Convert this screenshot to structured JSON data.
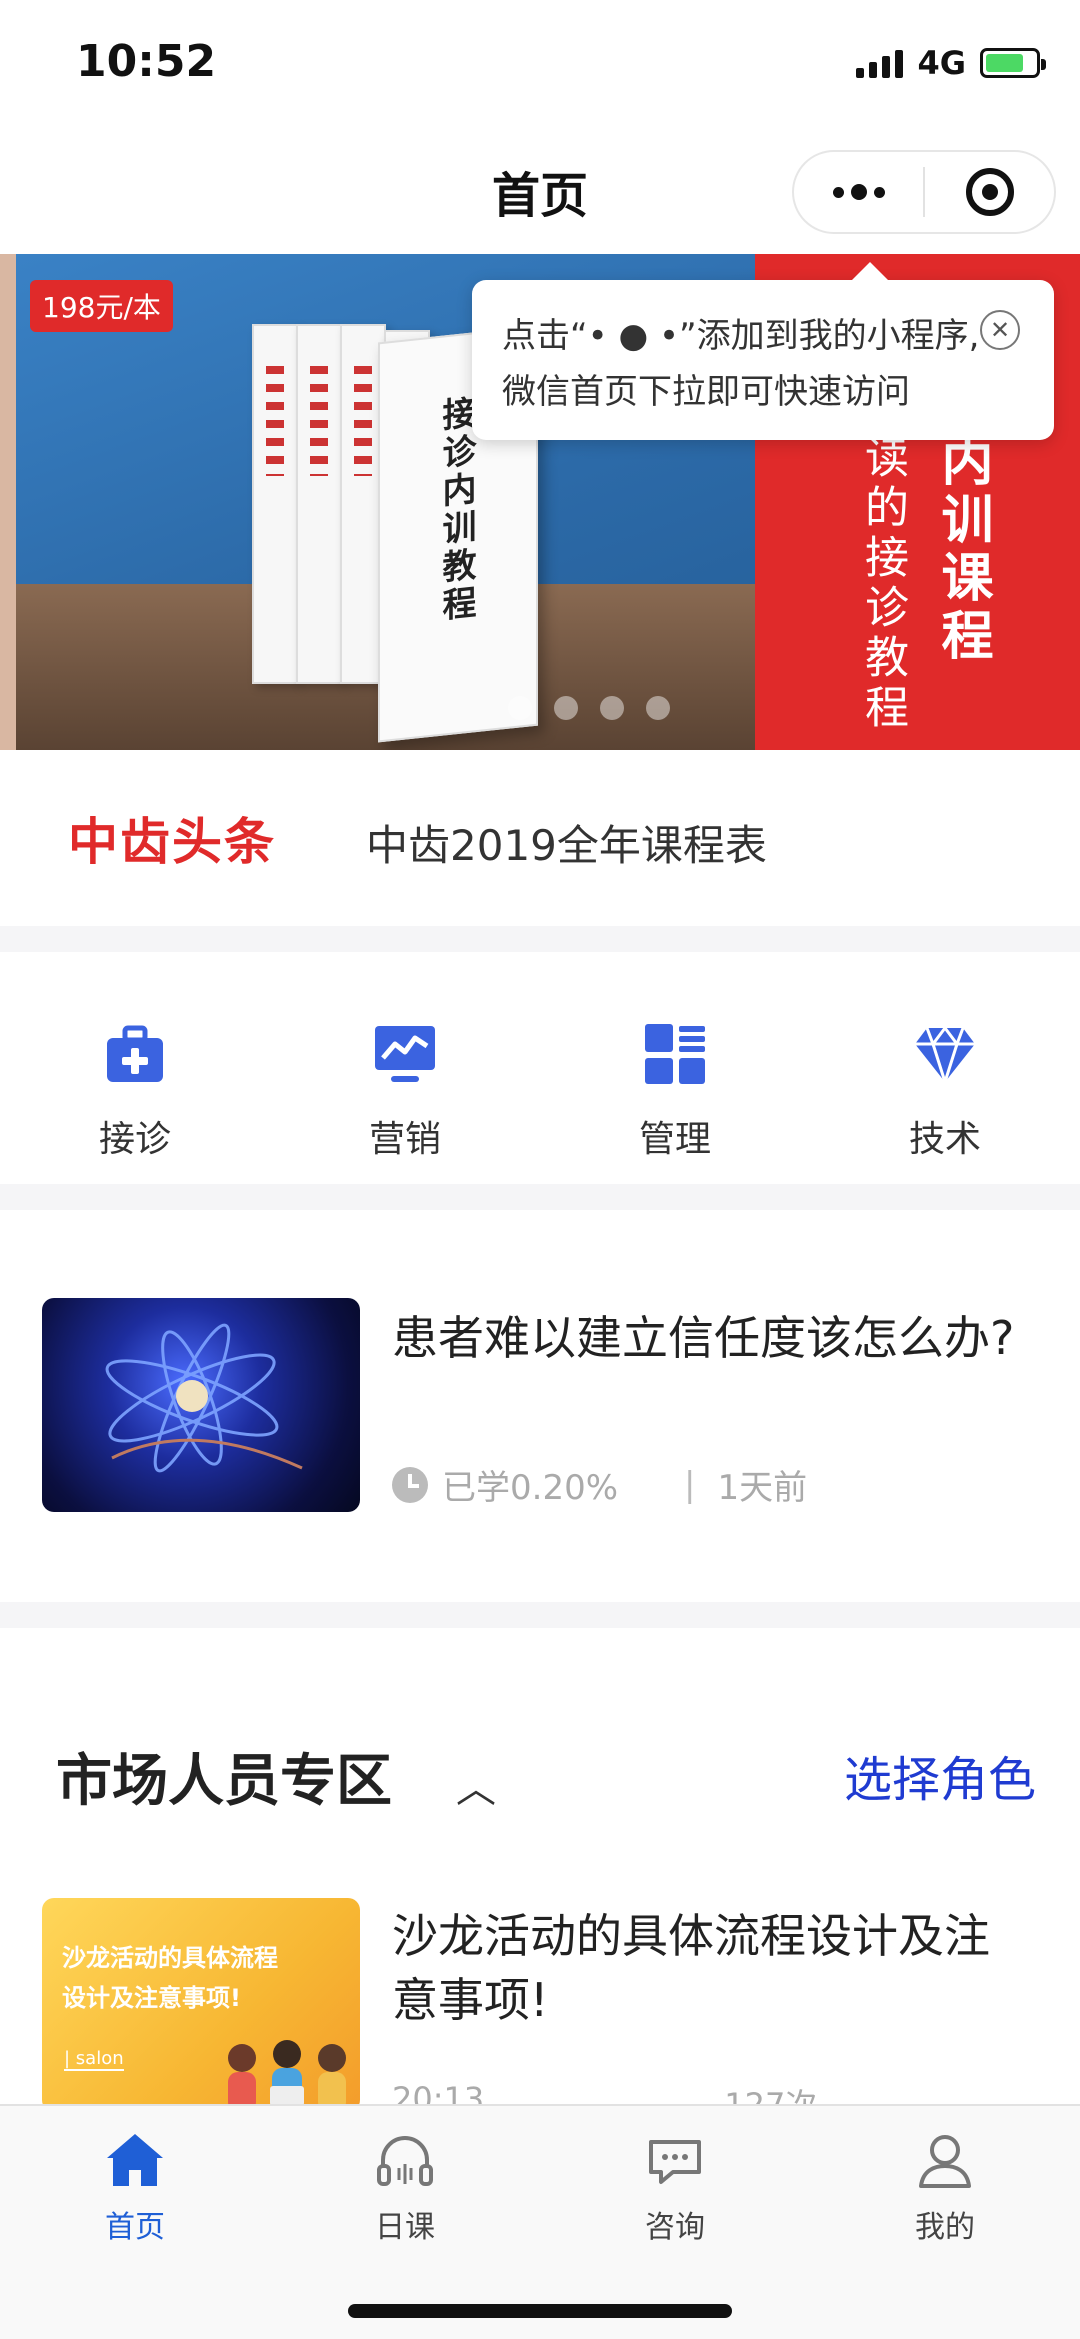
{
  "status_bar": {
    "time": "10:52",
    "network": "4G"
  },
  "nav": {
    "title": "首页"
  },
  "banner": {
    "price": "198元/本",
    "book_title": "接诊内训教程",
    "red_panel_line1": "内训课程",
    "red_panel_line2": "读的接诊教程"
  },
  "tooltip": {
    "line1": "点击“• ● •”添加到我的小程序,",
    "line2": "微信首页下拉即可快速访问"
  },
  "news": {
    "logo": "中齿头条",
    "headline": "中齿2019全年课程表"
  },
  "categories": [
    {
      "label": "接诊",
      "icon": "medical-kit-icon"
    },
    {
      "label": "营销",
      "icon": "trend-chart-icon"
    },
    {
      "label": "管理",
      "icon": "grid-list-icon"
    },
    {
      "label": "技术",
      "icon": "diamond-icon"
    }
  ],
  "lesson": {
    "title": "患者难以建立信任度该怎么办?",
    "progress": "已学0.20%",
    "time_ago": "1天前"
  },
  "zone": {
    "title": "市场人员专区",
    "action": "选择角色",
    "article": {
      "thumb_text_line1": "沙龙活动的具体流程",
      "thumb_text_line2": "设计及注意事项!",
      "thumb_sub": "| salon",
      "title": "沙龙活动的具体流程设计及注意事项!",
      "duration": "20:13",
      "views": "127次"
    }
  },
  "tabs": [
    {
      "label": "首页",
      "icon": "home-icon",
      "active": true
    },
    {
      "label": "日课",
      "icon": "headphones-icon",
      "active": false
    },
    {
      "label": "咨询",
      "icon": "chat-bubble-icon",
      "active": false
    },
    {
      "label": "我的",
      "icon": "user-icon",
      "active": false
    }
  ],
  "colors": {
    "accent": "#1f5fd6",
    "brand_red": "#e02a2a",
    "icon_blue": "#3b63e0"
  }
}
